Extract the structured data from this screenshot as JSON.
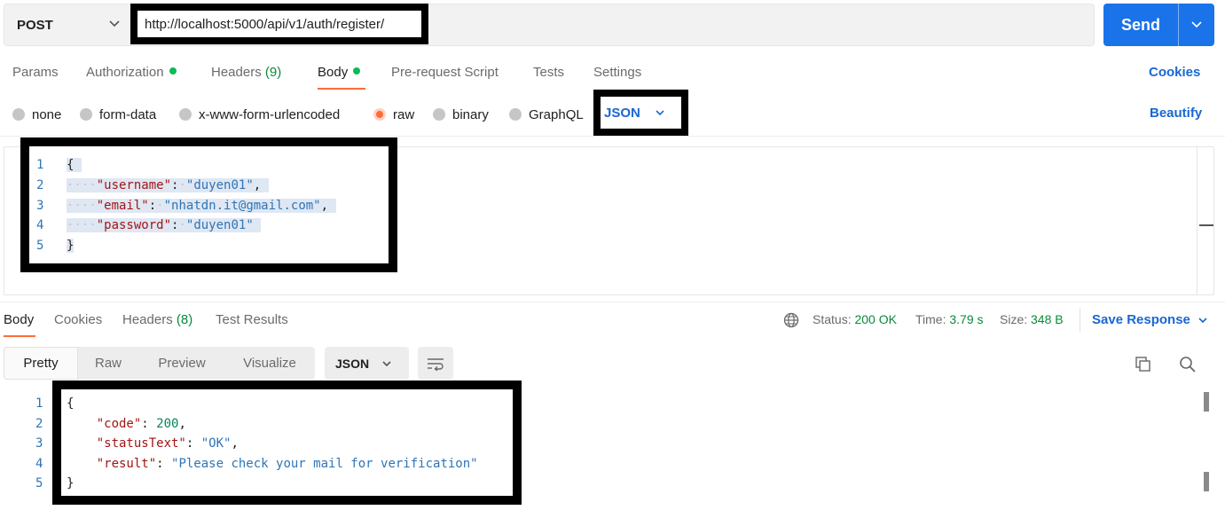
{
  "request": {
    "method": "POST",
    "url": "http://localhost:5000/api/v1/auth/register/",
    "send_label": "Send"
  },
  "request_tabs": [
    {
      "label": "Params"
    },
    {
      "label": "Authorization",
      "dot": true
    },
    {
      "label": "Headers",
      "count": "(9)"
    },
    {
      "label": "Body",
      "dot": true,
      "active": true
    },
    {
      "label": "Pre-request Script"
    },
    {
      "label": "Tests"
    },
    {
      "label": "Settings"
    }
  ],
  "cookies_link": "Cookies",
  "beautify_link": "Beautify",
  "body_types": [
    "none",
    "form-data",
    "x-www-form-urlencoded",
    "raw",
    "binary",
    "GraphQL"
  ],
  "body_type_selected": "raw",
  "body_format": "JSON",
  "request_body": {
    "line_numbers": [
      "1",
      "2",
      "3",
      "4",
      "5"
    ],
    "open_brace": "{",
    "close_brace": "}",
    "fields": [
      {
        "key": "\"username\"",
        "value": "\"duyen01\"",
        "comma": ","
      },
      {
        "key": "\"email\"",
        "value": "\"nhatdn.it@gmail.com\"",
        "comma": ","
      },
      {
        "key": "\"password\"",
        "value": "\"duyen01\"",
        "comma": ""
      }
    ]
  },
  "response_tabs": [
    {
      "label": "Body",
      "active": true
    },
    {
      "label": "Cookies"
    },
    {
      "label": "Headers",
      "count": "(8)"
    },
    {
      "label": "Test Results"
    }
  ],
  "response_meta": {
    "status_label": "Status:",
    "status_value": "200 OK",
    "time_label": "Time:",
    "time_value": "3.79 s",
    "size_label": "Size:",
    "size_value": "348 B",
    "save_response": "Save Response"
  },
  "view_modes": [
    "Pretty",
    "Raw",
    "Preview",
    "Visualize"
  ],
  "response_format": "JSON",
  "response_body": {
    "line_numbers": [
      "1",
      "2",
      "3",
      "4",
      "5"
    ],
    "open_brace": "{",
    "close_brace": "}",
    "code_key": "\"code\"",
    "code_value": "200",
    "status_key": "\"statusText\"",
    "status_value": "\"OK\"",
    "result_key": "\"result\"",
    "result_value": "\"Please check your mail for verification\""
  },
  "colors": {
    "accent_orange": "#ff6c37",
    "send_blue": "#1a73e8",
    "link_blue": "#1967d2",
    "success_green": "#0cbb52"
  },
  "icons": [
    "chevron-down-icon",
    "globe-icon",
    "wrap-lines-icon",
    "copy-icon",
    "search-icon"
  ]
}
